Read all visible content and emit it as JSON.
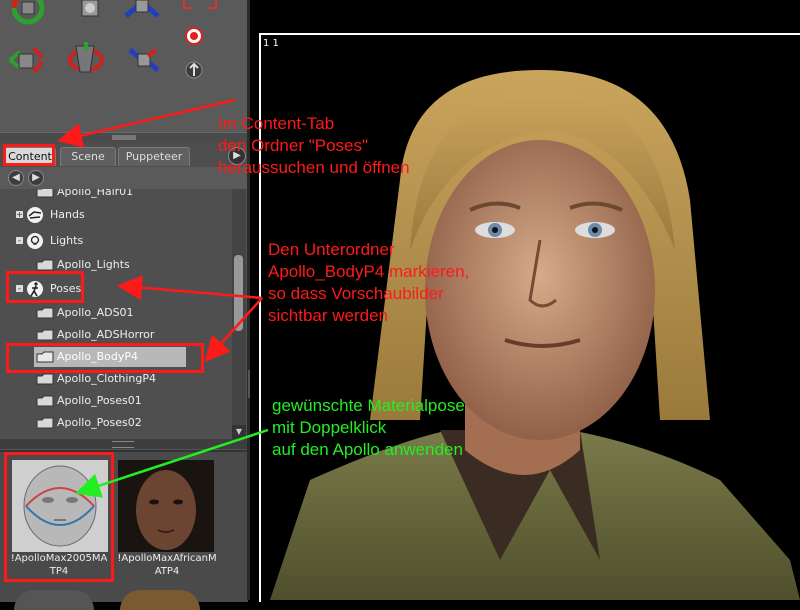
{
  "tabs": [
    {
      "label": "Content",
      "active": true
    },
    {
      "label": "Scene",
      "active": false
    },
    {
      "label": "Puppeteer",
      "active": false
    }
  ],
  "nav": {
    "back_icon": "arrow-left-icon",
    "forward_icon": "arrow-right-icon"
  },
  "tree": {
    "items": [
      {
        "label": "Apollo_Hair01",
        "type": "folder"
      },
      {
        "label": "Hands",
        "type": "category",
        "expander": "+"
      },
      {
        "label": "Lights",
        "type": "category",
        "expander": "-"
      },
      {
        "label": "Apollo_Lights",
        "type": "folder"
      },
      {
        "label": "Poses",
        "type": "category",
        "expander": "-"
      },
      {
        "label": "Apollo_ADS01",
        "type": "folder"
      },
      {
        "label": "Apollo_ADSHorror",
        "type": "folder"
      },
      {
        "label": "Apollo_BodyP4",
        "type": "folder",
        "selected": true
      },
      {
        "label": "Apollo_ClothingP4",
        "type": "folder"
      },
      {
        "label": "Apollo_Poses01",
        "type": "folder"
      },
      {
        "label": "Apollo_Poses02",
        "type": "folder"
      }
    ]
  },
  "thumbnails": [
    {
      "label_line1": "!ApolloMax2005MA",
      "label_line2": "TP4"
    },
    {
      "label_line1": "!ApolloMaxAfricanM",
      "label_line2": "ATP4"
    }
  ],
  "viewport": {
    "corner_label": "1  1"
  },
  "annotations": {
    "content_tab": {
      "line1": "Im Content-Tab",
      "line2": "den Ordner \"Poses\"",
      "line3": "heraussuchen und öffnen"
    },
    "subfolder": {
      "line1": "Den Unterordner",
      "line2": "Apollo_BodyP4 markieren,",
      "line3": "so dass Vorschaubilder",
      "line4": "sichtbar werden"
    },
    "material": {
      "line1": "gewünschte Materialpose",
      "line2": "mit Doppelklick",
      "line3": "auf den Apollo anwenden"
    }
  },
  "colors": {
    "annotation_red": "#ff1a1a",
    "annotation_green": "#22ee22",
    "selection": "#b8b8b8"
  }
}
